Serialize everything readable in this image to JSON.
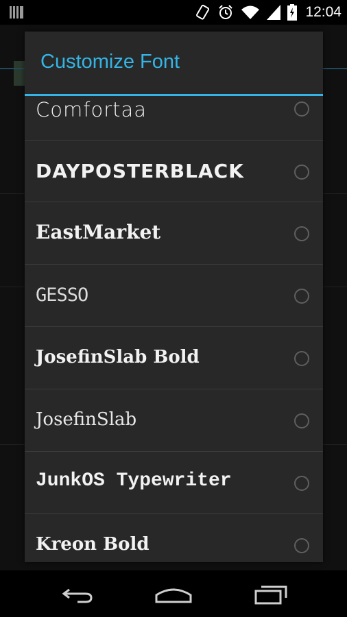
{
  "status_bar": {
    "time": "12:04",
    "icons": [
      "notification-icon",
      "rotate-icon",
      "alarm-icon",
      "wifi-icon",
      "signal-icon",
      "battery-charging-icon"
    ]
  },
  "dialog": {
    "title": "Customize Font",
    "accent_color": "#34b5e5",
    "fonts": [
      {
        "label": "Comfortaa",
        "selected": false
      },
      {
        "label": "DayPosterBlack",
        "selected": false
      },
      {
        "label": "EastMarket",
        "selected": false
      },
      {
        "label": "GESSO",
        "selected": false
      },
      {
        "label": "JosefinSlab Bold",
        "selected": false
      },
      {
        "label": "JosefinSlab",
        "selected": false
      },
      {
        "label": "JunkOS Typewriter",
        "selected": false
      },
      {
        "label": "Kreon Bold",
        "selected": false
      }
    ]
  },
  "nav_bar": {
    "icons": [
      "back-icon",
      "home-icon",
      "recent-apps-icon"
    ]
  }
}
